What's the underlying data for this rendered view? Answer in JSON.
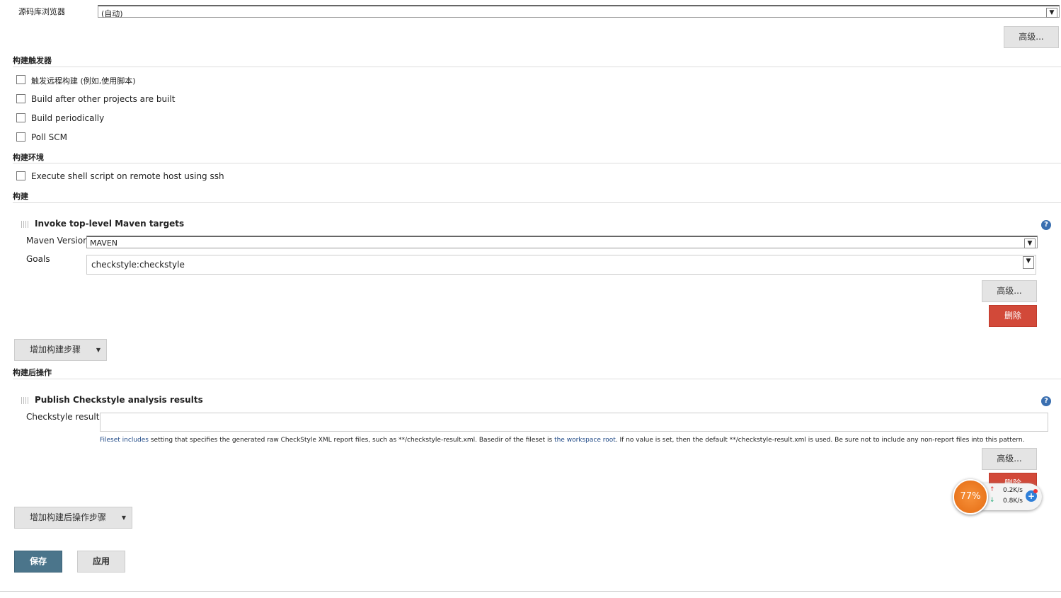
{
  "scm_browser": {
    "label": "源码库浏览器",
    "value": "(自动)",
    "advanced": "高级..."
  },
  "triggers": {
    "title": "构建触发器",
    "items": [
      "触发远程构建 (例如,使用脚本)",
      "Build after other projects are built",
      "Build periodically",
      "Poll SCM"
    ]
  },
  "env": {
    "title": "构建环境",
    "items": [
      "Execute shell script on remote host using ssh"
    ]
  },
  "build": {
    "title": "构建",
    "step_title": "Invoke top-level Maven targets",
    "maven_label": "Maven Version",
    "maven_value": "MAVEN",
    "goals_label": "Goals",
    "goals_value": "checkstyle:checkstyle",
    "advanced": "高级...",
    "delete": "删除",
    "add_step": "增加构建步骤"
  },
  "post": {
    "title": "构建后操作",
    "step_title": "Publish Checkstyle analysis results",
    "results_label": "Checkstyle results",
    "results_value": "",
    "help_link1": "Fileset includes",
    "help_text1": " setting that specifies the generated raw CheckStyle XML report files, such as **/checkstyle-result.xml. Basedir of the fileset is ",
    "help_link2": "the workspace root",
    "help_text2": ". If no value is set, then the default **/checkstyle-result.xml is used. Be sure not to include any non-report files into this pattern.",
    "advanced": "高级...",
    "delete": "删除",
    "add_step": "增加构建后操作步骤"
  },
  "footer": {
    "save": "保存",
    "apply": "应用"
  },
  "widget": {
    "percent": "77%",
    "up": "0.2K/s",
    "down": "0.8K/s"
  }
}
